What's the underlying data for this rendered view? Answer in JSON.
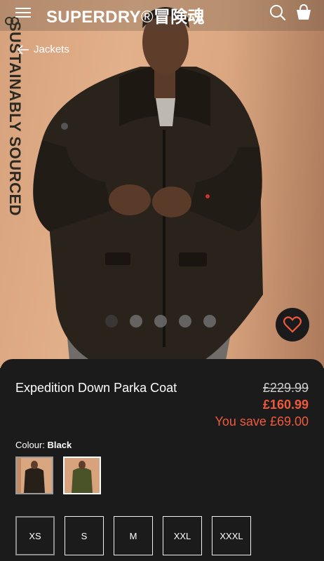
{
  "header": {
    "brand": "SUPERDRY",
    "brand_reg": "®",
    "brand_jp": "冒険魂",
    "icons": [
      "hamburger-menu-icon",
      "search-icon",
      "shopping-bag-icon"
    ]
  },
  "hero": {
    "badge_text": "SUSTAINABLY SOURCED",
    "back_label": "Jackets",
    "carousel": {
      "count": 5,
      "active_index": 0
    },
    "wishlist_icon": "heart-icon"
  },
  "product": {
    "name": "Expedition Down Parka Coat",
    "price_original": "£229.99",
    "price_sale": "£160.99",
    "saving": "You save £69.00",
    "colour_label": "Colour: ",
    "colour_value": "Black",
    "swatches": [
      {
        "colour": "black",
        "selected": true
      },
      {
        "colour": "khaki",
        "selected": false
      }
    ],
    "sizes": [
      "XS",
      "S",
      "M",
      "XXL",
      "XXXL"
    ],
    "selected_size": "XS"
  },
  "colors": {
    "accent": "#f05a3c",
    "panel": "#1c1b1b",
    "background": "#d9a680"
  }
}
